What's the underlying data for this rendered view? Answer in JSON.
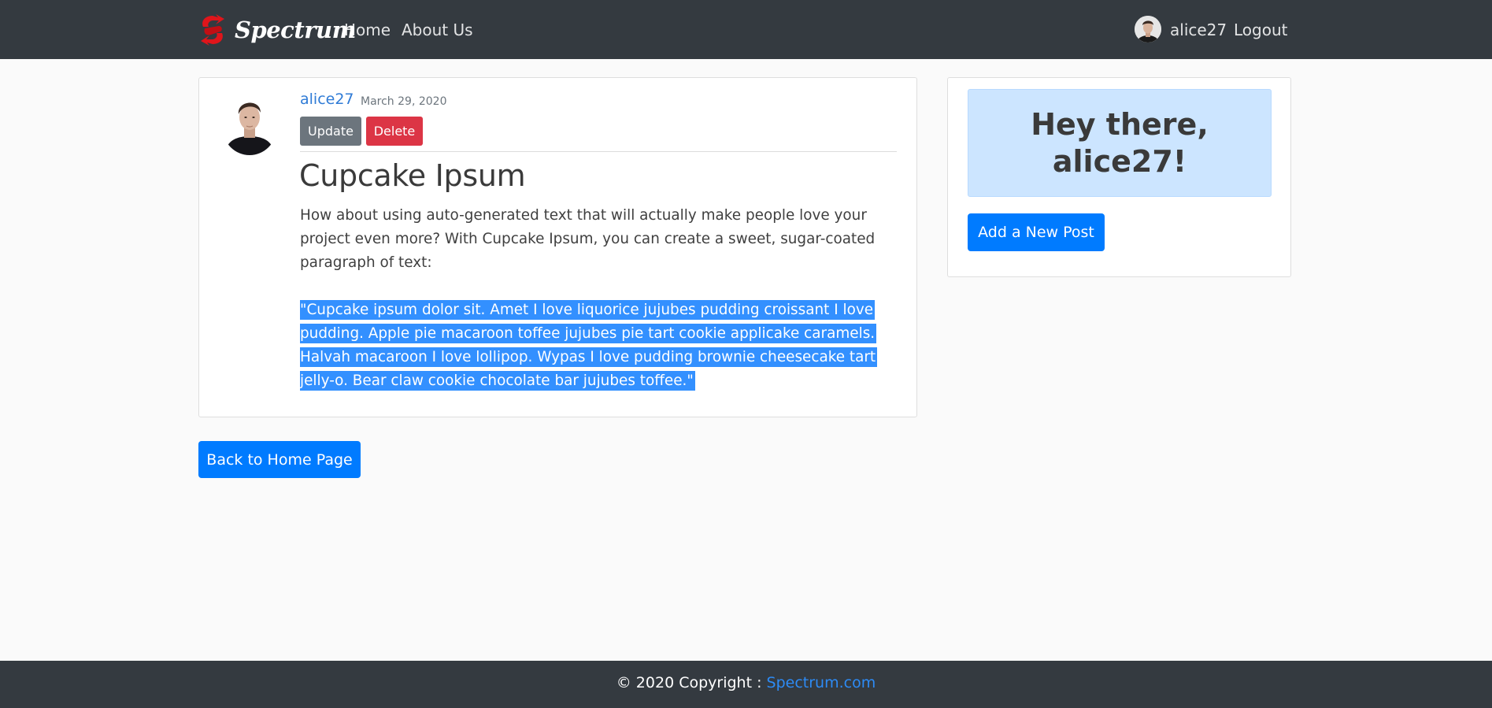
{
  "navbar": {
    "brand": "Spectrum",
    "links": [
      {
        "label": "Home"
      },
      {
        "label": "About Us"
      }
    ],
    "user": "alice27",
    "logout": "Logout",
    "icons": {
      "logo": "spectrum-logo-icon",
      "avatar": "user-avatar"
    }
  },
  "post": {
    "author": "alice27",
    "date": "March 29, 2020",
    "update_label": "Update",
    "delete_label": "Delete",
    "title": "Cupcake Ipsum",
    "intro": "How about using auto-generated text that will actually make people love your project even more? With Cupcake Ipsum, you can create a sweet, sugar-coated paragraph of text:",
    "quote": "\"Cupcake ipsum dolor sit. Amet I love liquorice jujubes pudding croissant I love pudding. Apple pie macaroon toffee jujubes pie tart cookie applicake caramels. Halvah macaroon I love lollipop. Wypas I love pudding brownie cheesecake tart jelly-o. Bear claw cookie chocolate bar jujubes toffee.\""
  },
  "sidebar": {
    "greeting": "Hey there, alice27!",
    "new_post_label": "Add a New Post"
  },
  "back_label": "Back to Home Page",
  "footer": {
    "copyright": "© 2020 Copyright : ",
    "link": "Spectrum.com"
  },
  "colors": {
    "navbar": "#343a40",
    "primary": "#007bff",
    "secondary": "#6c757d",
    "danger": "#dc3545",
    "alert": "#cce5ff",
    "selection": "#3390ff"
  }
}
